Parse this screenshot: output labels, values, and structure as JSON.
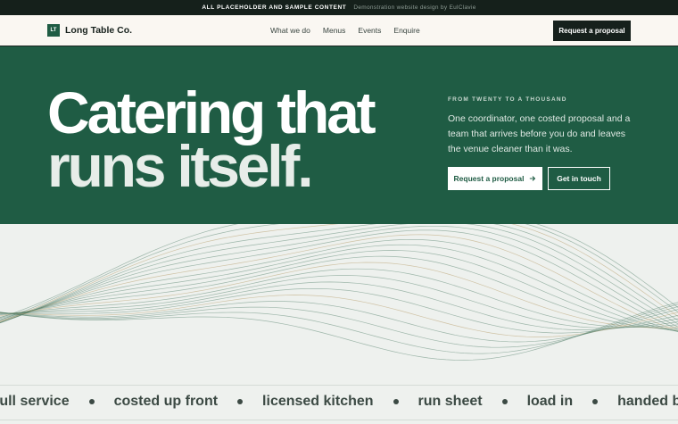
{
  "banner": {
    "label": "ALL PLACEHOLDER AND SAMPLE CONTENT",
    "credit": "Demonstration website design by EulClavie"
  },
  "brand": {
    "mark": "LT",
    "name": "Long Table Co."
  },
  "nav": {
    "items": [
      "What we do",
      "Menus",
      "Events",
      "Enquire"
    ],
    "cta": "Request a proposal"
  },
  "hero": {
    "headline_line1": "Catering that",
    "headline_line2": "runs itself.",
    "eyebrow": "FROM TWENTY TO A THOUSAND",
    "lede": "One coordinator, one costed proposal and a team that arrives before you do and leaves the venue cleaner than it was.",
    "primary_cta": "Request a proposal",
    "secondary_cta": "Get in touch"
  },
  "ticker": {
    "items": [
      "full service",
      "costed up front",
      "licensed kitchen",
      "run sheet",
      "load in",
      "handed back"
    ]
  },
  "colors": {
    "hero_green": "#1f5c44",
    "dark": "#16201c",
    "line_green": "#4f7d68",
    "line_gold": "#b79c6a"
  }
}
